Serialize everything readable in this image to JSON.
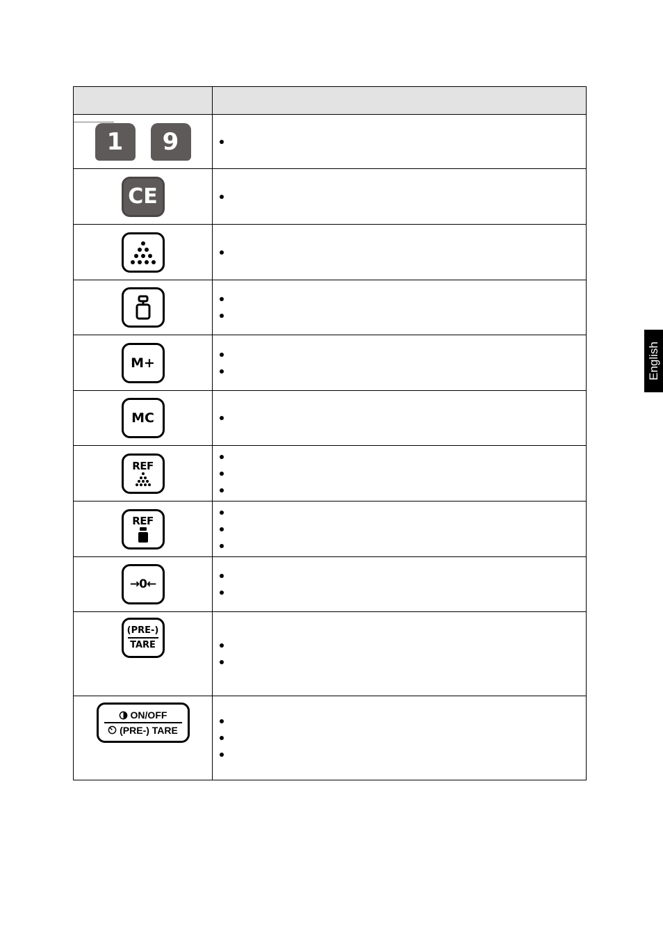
{
  "table": {
    "header": {
      "key_col": "",
      "description_col": ""
    },
    "rows": [
      {
        "key": {
          "type": "numeric-pair",
          "labels": [
            "1",
            "9"
          ]
        },
        "bullets": [
          ""
        ]
      },
      {
        "key": {
          "type": "dark",
          "label": "CE"
        },
        "bullets": [
          ""
        ]
      },
      {
        "key": {
          "type": "outline-icon",
          "icon": "piece-count-dots-icon"
        },
        "bullets": [
          ""
        ]
      },
      {
        "key": {
          "type": "outline-icon",
          "icon": "weight-icon"
        },
        "bullets": [
          "",
          ""
        ]
      },
      {
        "key": {
          "type": "outline-text",
          "label": "M+"
        },
        "bullets": [
          "",
          ""
        ]
      },
      {
        "key": {
          "type": "outline-text",
          "label": "MC"
        },
        "bullets": [
          ""
        ]
      },
      {
        "key": {
          "type": "outline-ref",
          "label": "REF",
          "icon": "piece-count-dots-icon"
        },
        "bullets": [
          "",
          "",
          ""
        ]
      },
      {
        "key": {
          "type": "outline-ref",
          "label": "REF",
          "icon": "weight-filled-icon"
        },
        "bullets": [
          "",
          "",
          ""
        ]
      },
      {
        "key": {
          "type": "outline-text",
          "label": "→0←"
        },
        "bullets": [
          "",
          ""
        ]
      },
      {
        "key": {
          "type": "outline-split",
          "top": "(PRE-)",
          "bottom": "TARE"
        },
        "bullets": [
          "",
          ""
        ]
      },
      {
        "key": {
          "type": "wide-split",
          "top": "ON/OFF",
          "bottom": "(PRE-) TARE"
        },
        "bullets": [
          "",
          "",
          ""
        ]
      }
    ]
  },
  "language_tab": {
    "label": "English"
  },
  "colors": {
    "header_bg": "#e3e3e3",
    "dark_key": "#5f5a5a",
    "tab_bg": "#000000"
  }
}
